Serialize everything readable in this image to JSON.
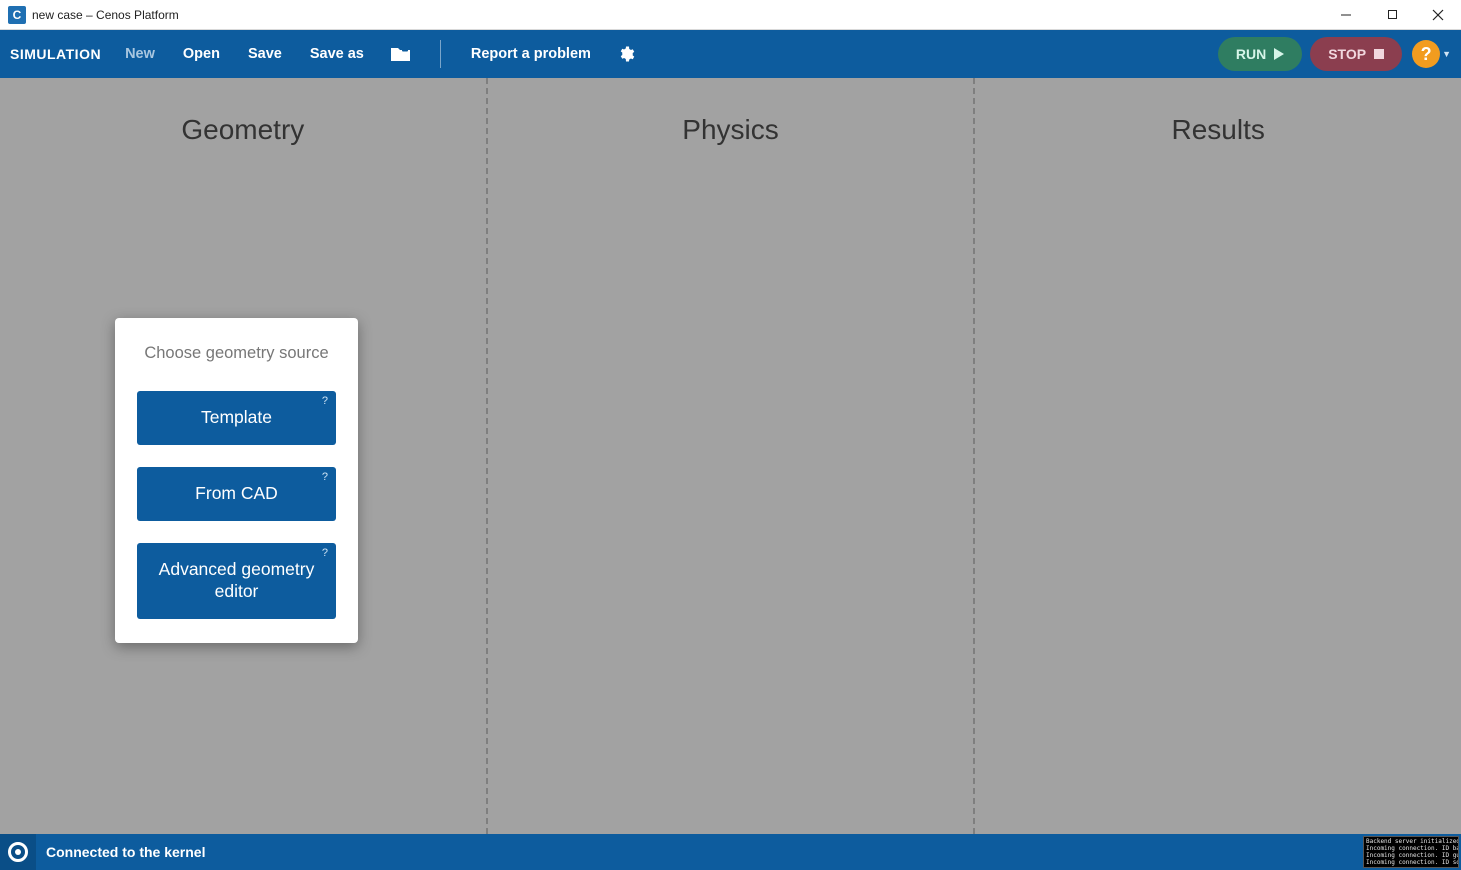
{
  "window": {
    "app_icon_letter": "C",
    "title": "new case – Cenos Platform"
  },
  "toolbar": {
    "simulation_label": "SIMULATION",
    "new_label": "New",
    "open_label": "Open",
    "save_label": "Save",
    "save_as_label": "Save as",
    "report_label": "Report a problem",
    "settings_icon_semantic": "gear-icon",
    "folder_icon_semantic": "folder-icon",
    "run_label": "RUN",
    "stop_label": "STOP",
    "help_symbol": "?"
  },
  "workspace": {
    "columns": {
      "geometry": "Geometry",
      "physics": "Physics",
      "results": "Results"
    },
    "geometry_source_card": {
      "title": "Choose geometry source",
      "options": {
        "template": "Template",
        "from_cad": "From CAD",
        "advanced": "Advanced geometry editor"
      },
      "hint_symbol": "?"
    }
  },
  "statusbar": {
    "text": "Connected to the kernel",
    "console_log": "Backend server initialized.\nIncoming connection. ID back:\nIncoming connection. ID gui\nIncoming connection. ID solu"
  }
}
